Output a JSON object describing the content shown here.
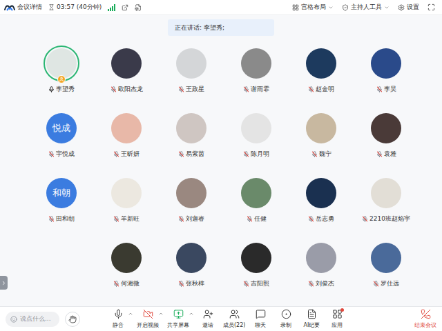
{
  "topBar": {
    "meetingInfo": "会议详情",
    "timer": "03:57 (40分钟)",
    "layout": "宫格布局",
    "hostTools": "主持人工具",
    "settings": "设置"
  },
  "speakingBanner": "正在讲话: 李望秀;",
  "participants": [
    {
      "name": "李望秀",
      "kind": "photo",
      "initials": "",
      "color": "#dfe6e3",
      "muted": false,
      "speaking": true,
      "host": true
    },
    {
      "name": "欧阳杰龙",
      "kind": "photo",
      "initials": "",
      "color": "#3a3a4a",
      "muted": true,
      "speaking": false,
      "host": false
    },
    {
      "name": "王政星",
      "kind": "photo",
      "initials": "",
      "color": "#d4d6d8",
      "muted": true,
      "speaking": false,
      "host": false
    },
    {
      "name": "谢雨霏",
      "kind": "photo",
      "initials": "",
      "color": "#8a8a8a",
      "muted": true,
      "speaking": false,
      "host": false
    },
    {
      "name": "赵金明",
      "kind": "photo",
      "initials": "",
      "color": "#1d3a5e",
      "muted": true,
      "speaking": false,
      "host": false
    },
    {
      "name": "李昊",
      "kind": "photo",
      "initials": "",
      "color": "#2a4a8a",
      "muted": true,
      "speaking": false,
      "host": false
    },
    {
      "name": "宇悦成",
      "kind": "text",
      "initials": "悦成",
      "color": "#3b7ce0",
      "muted": true,
      "speaking": false,
      "host": false
    },
    {
      "name": "王昕妍",
      "kind": "photo",
      "initials": "",
      "color": "#e8b8a8",
      "muted": true,
      "speaking": false,
      "host": false
    },
    {
      "name": "易紫茵",
      "kind": "photo",
      "initials": "",
      "color": "#cfc6c2",
      "muted": true,
      "speaking": false,
      "host": false
    },
    {
      "name": "陈月明",
      "kind": "photo",
      "initials": "",
      "color": "#e4e4e4",
      "muted": true,
      "speaking": false,
      "host": false
    },
    {
      "name": "魏宁",
      "kind": "photo",
      "initials": "",
      "color": "#c8b8a0",
      "muted": true,
      "speaking": false,
      "host": false
    },
    {
      "name": "袁雅",
      "kind": "photo",
      "initials": "",
      "color": "#4a3a38",
      "muted": true,
      "speaking": false,
      "host": false
    },
    {
      "name": "田和朝",
      "kind": "text",
      "initials": "和朝",
      "color": "#3b7ce0",
      "muted": true,
      "speaking": false,
      "host": false
    },
    {
      "name": "羊新旺",
      "kind": "photo",
      "initials": "",
      "color": "#ece8e0",
      "muted": true,
      "speaking": false,
      "host": false
    },
    {
      "name": "刘迦睿",
      "kind": "photo",
      "initials": "",
      "color": "#9a8880",
      "muted": true,
      "speaking": false,
      "host": false
    },
    {
      "name": "任健",
      "kind": "photo",
      "initials": "",
      "color": "#6a8a6a",
      "muted": true,
      "speaking": false,
      "host": false
    },
    {
      "name": "岳志勇",
      "kind": "photo",
      "initials": "",
      "color": "#1a3050",
      "muted": true,
      "speaking": false,
      "host": false
    },
    {
      "name": "2210班赵焰宇",
      "kind": "photo",
      "initials": "",
      "color": "#e2ded6",
      "muted": true,
      "speaking": false,
      "host": false
    },
    {
      "name": "何湘微",
      "kind": "photo",
      "initials": "",
      "color": "#3a3a30",
      "muted": true,
      "speaking": false,
      "host": false
    },
    {
      "name": "张秋梓",
      "kind": "photo",
      "initials": "",
      "color": "#3a4860",
      "muted": true,
      "speaking": false,
      "host": false
    },
    {
      "name": "吉阳照",
      "kind": "photo",
      "initials": "",
      "color": "#2a2a2a",
      "muted": true,
      "speaking": false,
      "host": false
    },
    {
      "name": "刘俊杰",
      "kind": "photo",
      "initials": "",
      "color": "#9a9ca8",
      "muted": true,
      "speaking": false,
      "host": false
    },
    {
      "name": "罗仕远",
      "kind": "photo",
      "initials": "",
      "color": "#4a6a9a",
      "muted": true,
      "speaking": false,
      "host": false
    }
  ],
  "toolbar": {
    "chatPlaceholder": "说点什么...",
    "buttons": [
      {
        "label": "静音",
        "kind": "mic",
        "color": "#333333",
        "menu": true,
        "badge": false
      },
      {
        "label": "开启视频",
        "kind": "video-off",
        "color": "#e0473c",
        "menu": true,
        "badge": false
      },
      {
        "label": "共享屏幕",
        "kind": "share",
        "color": "#1aad5b",
        "menu": true,
        "badge": false
      },
      {
        "label": "邀请",
        "kind": "invite",
        "color": "#333333",
        "menu": false,
        "badge": false
      },
      {
        "label": "成员(22)",
        "kind": "members",
        "color": "#333333",
        "menu": false,
        "badge": false
      },
      {
        "label": "聊天",
        "kind": "chat",
        "color": "#333333",
        "menu": false,
        "badge": false
      },
      {
        "label": "录制",
        "kind": "record",
        "color": "#333333",
        "menu": false,
        "badge": false
      },
      {
        "label": "AI纪要",
        "kind": "ai",
        "color": "#333333",
        "menu": false,
        "badge": false
      },
      {
        "label": "应用",
        "kind": "apps",
        "color": "#333333",
        "menu": false,
        "badge": true
      }
    ],
    "endButton": "结束会议"
  }
}
